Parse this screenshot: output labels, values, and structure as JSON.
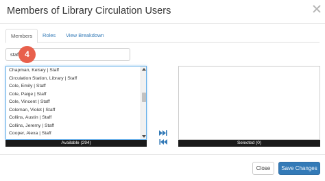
{
  "dialog": {
    "title": "Members of Library Circulation Users"
  },
  "tabs": [
    {
      "label": "Members",
      "active": true
    },
    {
      "label": "Roles",
      "active": false
    },
    {
      "label": "View Breakdown",
      "active": false
    }
  ],
  "search": {
    "value": "staff",
    "step_badge": "4"
  },
  "available": {
    "items": [
      "Chapman, Kelsey | Staff",
      "Circulation Station, Library | Staff",
      "Cole, Emily | Staff",
      "Cole, Paige | Staff",
      "Cole, Vincent | Staff",
      "Coleman, Violet | Staff",
      "Collins, Austin | Staff",
      "Collins, Jeremy | Staff",
      "Cooper, Alexa | Staff"
    ],
    "label": "Available (294)"
  },
  "selected": {
    "label": "Selected (0)"
  },
  "footer": {
    "close_label": "Close",
    "save_label": "Save Changes"
  },
  "colors": {
    "primary": "#337ab7",
    "badge": "#e8604c",
    "label_bar": "#1a1a1a",
    "focus_border": "#66afe9"
  },
  "icons": {
    "move_right": "fast-forward-icon",
    "move_left": "fast-backward-icon",
    "dismiss": "close-icon"
  }
}
